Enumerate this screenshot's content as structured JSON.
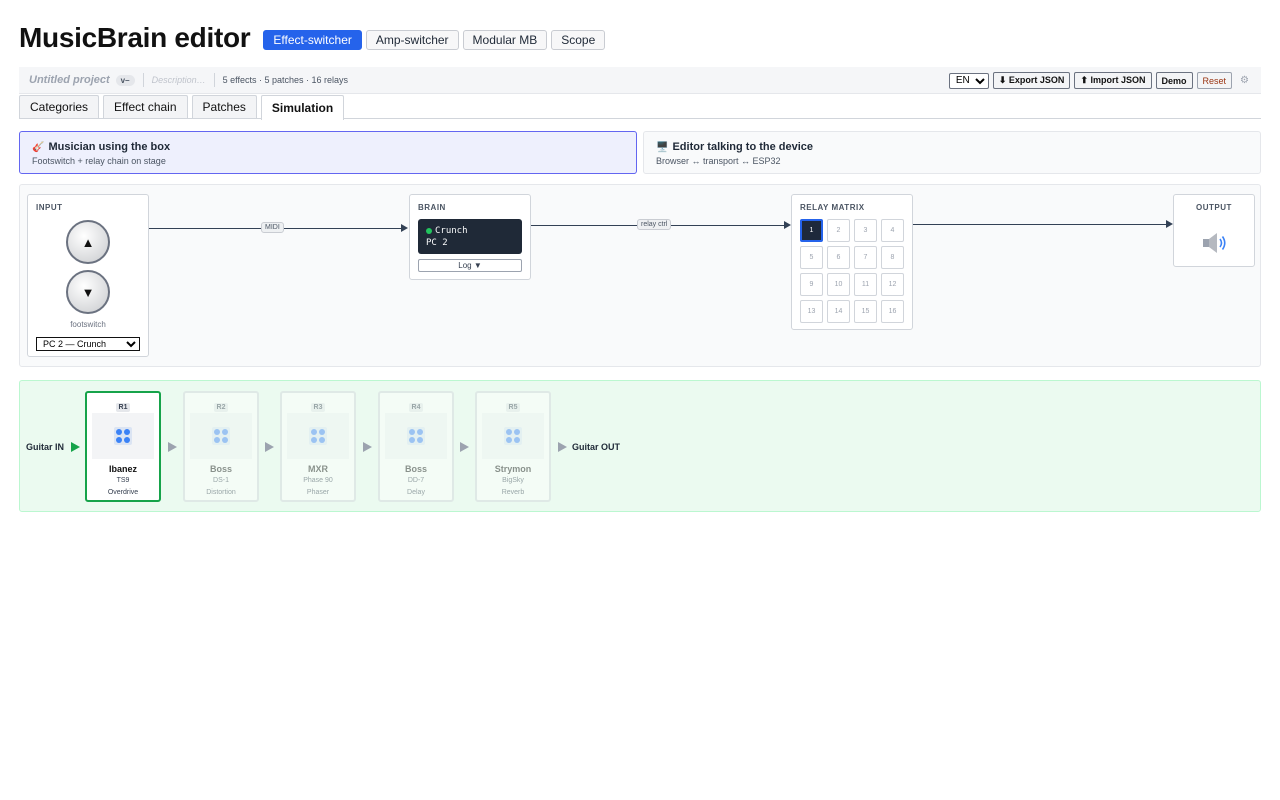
{
  "app": {
    "title": "MusicBrain editor"
  },
  "modes": [
    {
      "label": "Effect-switcher",
      "active": true
    },
    {
      "label": "Amp-switcher",
      "active": false
    },
    {
      "label": "Modular MB",
      "active": false
    },
    {
      "label": "Scope",
      "active": false
    }
  ],
  "project": {
    "name": "Untitled project",
    "version": "v–",
    "description_placeholder": "Description…",
    "stats": "5 effects · 5 patches · 16 relays",
    "language": "EN",
    "export_label": "⬇ Export JSON",
    "import_label": "⬆ Import JSON",
    "demo_label": "Demo",
    "reset_label": "Reset",
    "settings_glyph": "⚙"
  },
  "tabs": [
    {
      "label": "Categories",
      "active": false
    },
    {
      "label": "Effect chain",
      "active": false
    },
    {
      "label": "Patches",
      "active": false
    },
    {
      "label": "Simulation",
      "active": true
    }
  ],
  "views": [
    {
      "icon": "🎸",
      "title": "Musician using the box",
      "subtitle": "Footswitch + relay chain on stage",
      "active": true
    },
    {
      "icon": "🖥️",
      "title": "Editor talking to the device",
      "subtitle": "Browser ↔ transport ↔ ESP32",
      "active": false
    }
  ],
  "flow": {
    "input_label": "INPUT",
    "footswitch_up": "▲",
    "footswitch_down": "▼",
    "footswitch_caption": "footswitch",
    "patch_selected": "PC 2 — Crunch",
    "midi_label": "MIDI",
    "brain_label": "BRAIN",
    "brain_patch_name": "Crunch",
    "brain_patch_pc": "PC 2",
    "log_label": "Log ▼",
    "relay_ctrl_label": "relay ctrl",
    "relay_label": "RELAY MATRIX",
    "relays": [
      "1",
      "2",
      "3",
      "4",
      "5",
      "6",
      "7",
      "8",
      "9",
      "10",
      "11",
      "12",
      "13",
      "14",
      "15",
      "16"
    ],
    "relays_active": [
      "1"
    ],
    "output_label": "OUTPUT"
  },
  "chain": {
    "in_label": "Guitar IN",
    "out_label": "Guitar OUT",
    "pedals": [
      {
        "relay": "R1",
        "brand": "Ibanez",
        "model": "TS9",
        "category": "Overdrive",
        "active": true
      },
      {
        "relay": "R2",
        "brand": "Boss",
        "model": "DS-1",
        "category": "Distortion",
        "active": false
      },
      {
        "relay": "R3",
        "brand": "MXR",
        "model": "Phase 90",
        "category": "Phaser",
        "active": false
      },
      {
        "relay": "R4",
        "brand": "Boss",
        "model": "DD-7",
        "category": "Delay",
        "active": false
      },
      {
        "relay": "R5",
        "brand": "Strymon",
        "model": "BigSky",
        "category": "Reverb",
        "active": false
      }
    ]
  },
  "colors": {
    "accent": "#2563eb",
    "active_chain": "#16a34a",
    "brain_screen": "#1f2937"
  }
}
